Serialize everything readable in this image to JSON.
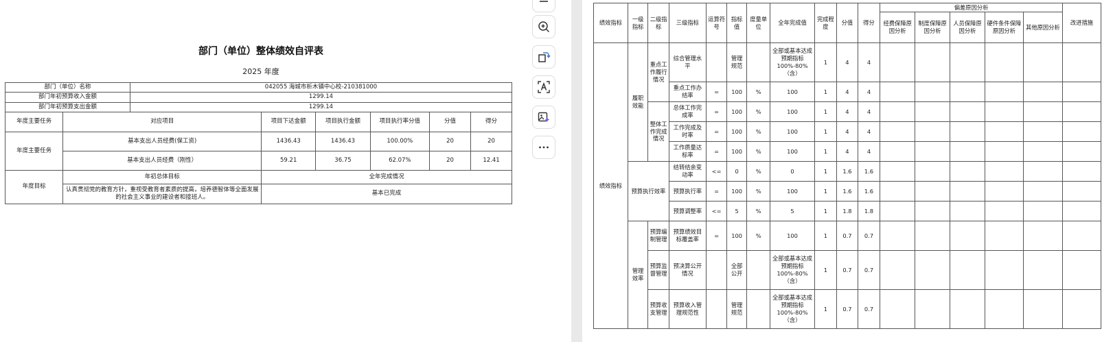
{
  "left": {
    "title": "部门（单位）整体绩效自评表",
    "year": "2025 年度",
    "info": [
      {
        "label": "部门（单位）名称",
        "value": "042055 海城市析木镇中心校-210381000"
      },
      {
        "label": "部门年初预算收入金额",
        "value": "1299.14"
      },
      {
        "label": "部门年初预算支出金额",
        "value": "1299.14"
      }
    ],
    "task_headers": [
      "年度主要任务",
      "对应项目",
      "项目下达金额",
      "项目执行金额",
      "项目执行率分值",
      "分值",
      "得分"
    ],
    "task_group_label": "年度主要任务",
    "tasks": [
      [
        "基本支出人员经费(保工资)",
        "1436.43",
        "1436.43",
        "100.00%",
        "20",
        "20"
      ],
      [
        "基本支出人员经费（刚性）",
        "59.21",
        "36.75",
        "62.07%",
        "20",
        "12.41"
      ]
    ],
    "goal_label": "年度目标",
    "goal_col1_header": "年初总体目标",
    "goal_col2_header": "全年完成情况",
    "goal_text": "认真贯彻党的教育方针，重视受教育者素质的提高，培养德智体等全面发展的社会主义事业的建设者和接班人。",
    "goal_status": "基本已完成"
  },
  "tools": [
    "panel-icon",
    "zoom-in-icon",
    "rotate-icon",
    "ocr-text-icon",
    "ai-image-icon",
    "more-icon"
  ],
  "right": {
    "headers": {
      "c1": "绩效指标",
      "c2": "一级指标",
      "c3": "二级指标",
      "c4": "三级指标",
      "c5": "运算符号",
      "c6": "指标值",
      "c7": "度量单位",
      "c8": "全年完成值",
      "c9": "完成程度",
      "c10": "分值",
      "c11": "得分",
      "deviation": "偏差原因分析",
      "d1": "经费保障原因分析",
      "d2": "制度保障原因分析",
      "d3": "人员保障原因分析",
      "d4": "硬件条件保障原因分析",
      "d5": "其他原因分析",
      "c12": "改进措施"
    },
    "main_label": "绩效指标",
    "groups": {
      "g1": "履职效能",
      "g1a": "重点工作履行情况",
      "g1b": "整体工作完成情况",
      "g2": "预算执行效率",
      "g3": "管理效率",
      "g3a": "预算编制管理",
      "g3b": "预算监督管理",
      "g3c": "预算收支管理"
    },
    "rows": [
      {
        "name": "综合管理水平",
        "op": "",
        "val": "管理规范",
        "unit": "",
        "done": "全部或基本达成预期指标 100%-80%（含）",
        "deg": "1",
        "score": "4",
        "got": "4"
      },
      {
        "name": "重点工作办结率",
        "op": "=",
        "val": "100",
        "unit": "%",
        "done": "100",
        "deg": "1",
        "score": "4",
        "got": "4"
      },
      {
        "name": "总体工作完成率",
        "op": "=",
        "val": "100",
        "unit": "%",
        "done": "100",
        "deg": "1",
        "score": "4",
        "got": "4"
      },
      {
        "name": "工作完成及时率",
        "op": "=",
        "val": "100",
        "unit": "%",
        "done": "100",
        "deg": "1",
        "score": "4",
        "got": "4"
      },
      {
        "name": "工作质量达标率",
        "op": "=",
        "val": "100",
        "unit": "%",
        "done": "100",
        "deg": "1",
        "score": "4",
        "got": "4"
      },
      {
        "name": "结转结余变动率",
        "op": "<=",
        "val": "0",
        "unit": "%",
        "done": "0",
        "deg": "1",
        "score": "1.6",
        "got": "1.6"
      },
      {
        "name": "预算执行率",
        "op": "=",
        "val": "100",
        "unit": "%",
        "done": "100",
        "deg": "1",
        "score": "1.6",
        "got": "1.6"
      },
      {
        "name": "预算调整率",
        "op": "<=",
        "val": "5",
        "unit": "%",
        "done": "5",
        "deg": "1",
        "score": "1.8",
        "got": "1.8"
      },
      {
        "name": "预算绩效目标覆盖率",
        "op": "=",
        "val": "100",
        "unit": "%",
        "done": "100",
        "deg": "1",
        "score": "0.7",
        "got": "0.7"
      },
      {
        "name": "预决算公开情况",
        "op": "",
        "val": "全部公开",
        "unit": "",
        "done": "全部或基本达成预期指标 100%-80%（含）",
        "deg": "1",
        "score": "0.7",
        "got": "0.7"
      },
      {
        "name": "预算收入管理规范性",
        "op": "",
        "val": "管理规范",
        "unit": "",
        "done": "全部或基本达成预期指标 100%-80%（含）",
        "deg": "1",
        "score": "0.7",
        "got": "0.7"
      }
    ]
  }
}
